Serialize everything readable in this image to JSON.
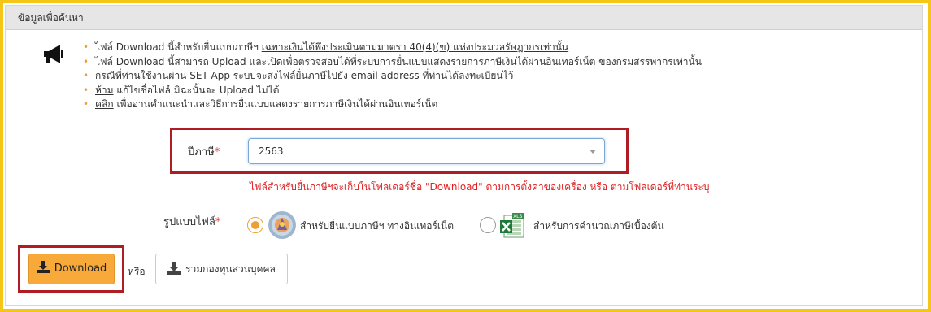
{
  "panel": {
    "title": "ข้อมูลเพื่อค้นหา"
  },
  "info": {
    "icon": "megaphone-icon",
    "notes": [
      {
        "text_before": "ไฟล์ Download นี้สำหรับยื่นแบบภาษีฯ ",
        "link": "เฉพาะเงินได้พึงประเมินตามมาตรา 40(4)(ข) แห่งประมวลรัษฎากรเท่านั้น",
        "text_after": ""
      },
      {
        "text_before": "ไฟล์ Download นี้สามารถ Upload และเปิดเพื่อตรวจสอบได้ที่ระบบการยื่นแบบแสดงรายการภาษีเงินได้ผ่านอินเทอร์เน็ต ของกรมสรรพากรเท่านั้น",
        "link": "",
        "text_after": ""
      },
      {
        "text_before": "กรณีที่ท่านใช้งานผ่าน SET App ระบบจะส่งไฟล์ยื่นภาษีไปยัง email address ที่ท่านได้ลงทะเบียนไว้",
        "link": "",
        "text_after": ""
      },
      {
        "text_before": "",
        "link": "ห้าม",
        "text_after": " แก้ไขชื่อไฟล์ มิฉะนั้นจะ Upload ไม่ได้"
      },
      {
        "text_before": "",
        "link": "คลิก",
        "text_after": " เพื่ออ่านคำแนะนำและวิธีการยื่นแบบแสดงรายการภาษีเงินได้ผ่านอินเทอร์เน็ต"
      }
    ]
  },
  "form": {
    "year_label": "ปีภาษี",
    "required_mark": "*",
    "year_value": "2563",
    "hint": "ไฟล์สำหรับยื่นภาษีฯจะเก็บในโฟลเดอร์ชื่อ \"Download\" ตามการตั้งค่าของเครื่อง หรือ ตามโฟลเดอร์ที่ท่านระบุ",
    "format_label": "รูปแบบไฟล์",
    "options": [
      {
        "label": "สำหรับยื่นแบบภาษีฯ ทางอินเทอร์เน็ต",
        "icon": "revenue-department-seal-icon",
        "selected": true
      },
      {
        "label": "สำหรับการคำนวณภาษีเบื้องต้น",
        "icon": "excel-xls-icon",
        "selected": false
      }
    ]
  },
  "actions": {
    "download_label": "Download",
    "or_text": "หรือ",
    "combine_label": "รวมกองทุนส่วนบุคคล"
  },
  "colors": {
    "accent": "#f7a93a",
    "highlight_box": "#b01c24",
    "frame": "#f5c518",
    "hint": "#e02020"
  }
}
